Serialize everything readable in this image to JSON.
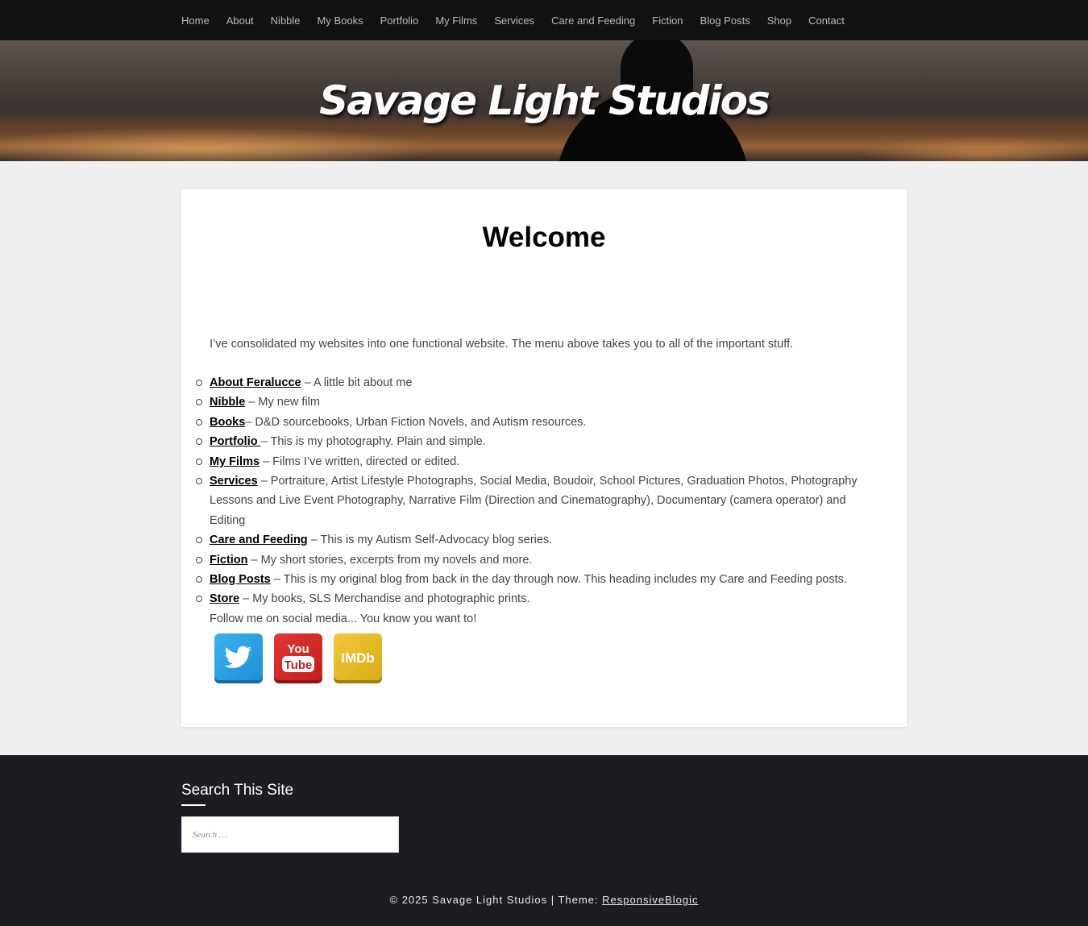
{
  "nav": {
    "items": [
      "Home",
      "About",
      "Nibble",
      "My Books",
      "Portfolio",
      "My Films",
      "Services",
      "Care and Feeding",
      "Fiction",
      "Blog Posts",
      "Shop",
      "Contact"
    ]
  },
  "header": {
    "site_title": "Savage Light Studios"
  },
  "main": {
    "heading": "Welcome",
    "intro": "I’ve consolidated my websites into one functional website. The menu above takes you to all of the important stuff.",
    "links": [
      {
        "label": "About Feralucce",
        "text": " – A little bit about me"
      },
      {
        "label": "Nibble",
        "text": " – My new film"
      },
      {
        "label": "Books",
        "text": "– D&D sourcebooks, Urban Fiction Novels, and Autism resources."
      },
      {
        "label": "Portfolio ",
        "text": "–  This is my photography. Plain and simple."
      },
      {
        "label": "My Films",
        "text": " – Films I’ve written, directed or edited."
      },
      {
        "label": "Services",
        "text": " – Portraiture, Artist Lifestyle Photographs, Social Media, Boudoir, School Pictures, Graduation Photos, Photography Lessons and Live Event Photography, Narrative Film (Direction and Cinematography), Documentary (camera operator) and Editing"
      },
      {
        "label": "Care and Feeding",
        "text": " – This is my Autism Self-Advocacy blog series."
      },
      {
        "label": "Fiction",
        "text": " – My short stories, excerpts from my novels and more."
      },
      {
        "label": "Blog Posts",
        "text": " – This is my original blog from back in the day through now. This heading includes my Care and Feeding posts."
      },
      {
        "label": "Store",
        "text": " – My books, SLS Merchandise and photographic prints."
      }
    ],
    "follow_text": "Follow me on social media... You know you want to!",
    "social": {
      "youtube_top": "You",
      "youtube_bottom": "Tube",
      "imdb": "IMDb",
      "colors": {
        "twitter": "#2aa3e6",
        "youtube": "#d42a2a",
        "imdb": "#e6bb2a"
      }
    }
  },
  "footer": {
    "widget_title": "Search This Site",
    "search_placeholder": "Search …",
    "copyright": "© 2025 Savage Light Studios | Theme: ",
    "theme_link": "ResponsiveBlogic"
  }
}
